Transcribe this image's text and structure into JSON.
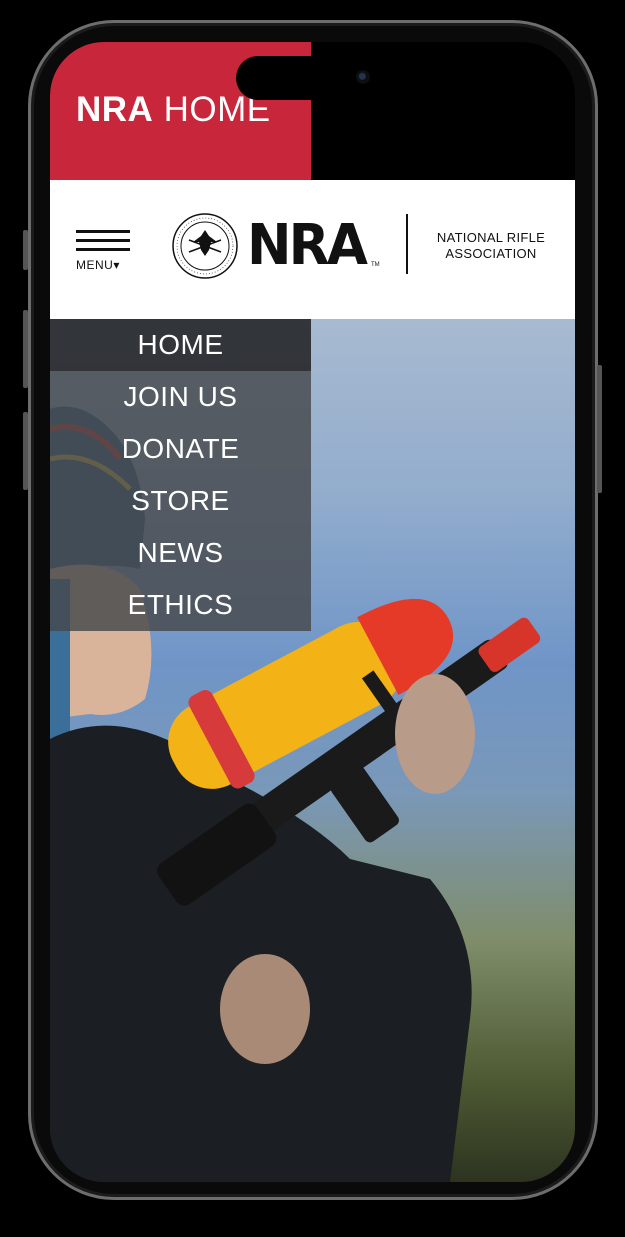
{
  "title": {
    "bold": "NRA",
    "thin": "HOME"
  },
  "header": {
    "menu_label": "MENU",
    "logo_text": "NRA",
    "org_name": "NATIONAL RIFLE ASSOCIATION"
  },
  "nav": {
    "items": [
      {
        "label": "HOME",
        "active": true
      },
      {
        "label": "JOIN US"
      },
      {
        "label": "DONATE"
      },
      {
        "label": "STORE"
      },
      {
        "label": "NEWS"
      },
      {
        "label": "ETHICS"
      }
    ]
  },
  "hero": {
    "image": "photo-child-holding-toy-water-gun"
  },
  "icons": {
    "menu": "hamburger-icon",
    "caret": "caret-down-icon",
    "seal": "nra-seal-logo"
  },
  "colors": {
    "accent_red": "#c8263a",
    "header_bg": "#ffffff",
    "nav_bg": "#46484c",
    "nav_active_bg": "#28292c"
  }
}
